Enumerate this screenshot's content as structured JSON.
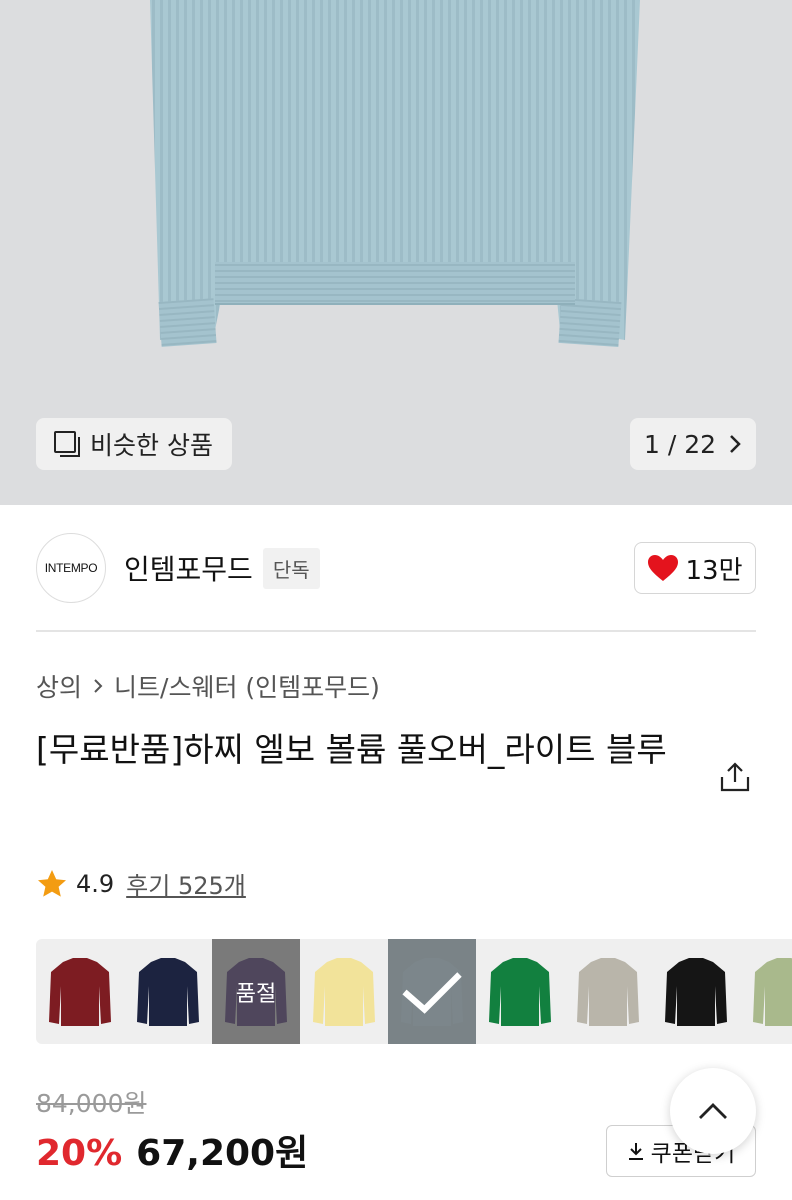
{
  "hero": {
    "similar_label": "비슷한 상품",
    "pager": "1 / 22"
  },
  "brand": {
    "logo_text": "INTEMPO",
    "name": "인템포무드",
    "tag": "단독",
    "likes": "13만"
  },
  "breadcrumb": {
    "category": "상의",
    "subcategory": "니트/스웨터 (인템포무드)"
  },
  "product": {
    "title": "[무료반품]하찌 엘보 볼륨 풀오버_라이트 블루",
    "rating": "4.9",
    "reviews": "후기 525개"
  },
  "colors": {
    "soldout_label": "품절",
    "swatches": [
      "#7d1c22",
      "#1c2340",
      "#2a1847",
      "#f2e39a",
      "#8e9aa1",
      "#12803f",
      "#b9b5aa",
      "#151515",
      "#a9b98c"
    ]
  },
  "price": {
    "original": "84,000원",
    "discount": "20%",
    "sale": "67,200원",
    "coupon_label": "쿠폰받기"
  },
  "accent": {
    "red": "#e0282e",
    "heart": "#e4131d",
    "star": "#f39c12"
  }
}
